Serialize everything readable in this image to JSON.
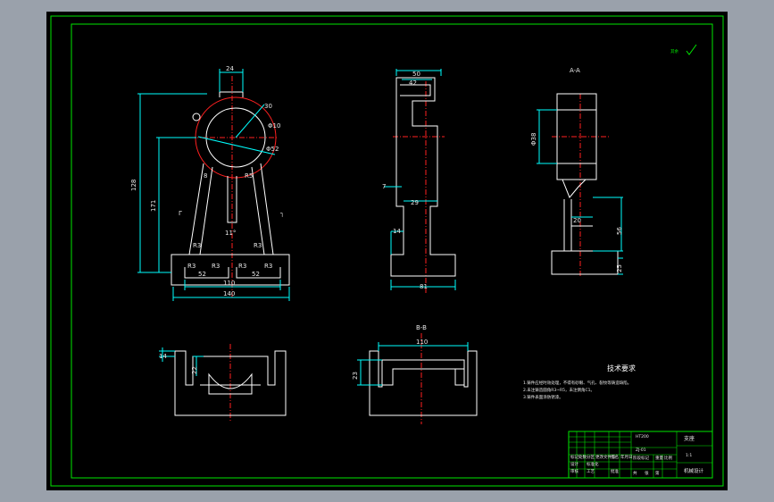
{
  "colors": {
    "background": "#000000",
    "frame": "#00e600",
    "outline": "#ffffff",
    "dimension": "#00ffff",
    "centerline": "#ff2020",
    "workspace": "#9aa1ab"
  },
  "front_view": {
    "dims": {
      "top_width": "24",
      "height_total": "128",
      "height_center": "171",
      "arc_r30": "30",
      "dia_phi10": "Φ10",
      "dia_phi52": "Φ52",
      "leg_r8_left": "8",
      "leg_r8_right": "R5",
      "fillet_left": "R3",
      "fillet_right": "R3",
      "angle": "11°",
      "base_r3_a": "R3",
      "base_r3_b": "R3",
      "base_r3_c": "R3",
      "base_r3_d": "R3",
      "slot_left": "52",
      "slot_right": "52",
      "inner_width": "110",
      "outer_width": "140",
      "section_mark_left": "Γ",
      "section_mark_right": "┐"
    }
  },
  "side_view": {
    "dims": {
      "top_outer": "50",
      "top_inner": "42",
      "step": "7",
      "neck": "29",
      "base_h": "14",
      "base_w": "81"
    }
  },
  "section_view": {
    "label": "A-A",
    "dims": {
      "bore": "Φ38",
      "rib": "20",
      "height": "56",
      "base": "25"
    }
  },
  "top_view_left": {
    "dims": {
      "wall": "14",
      "slot": "22"
    }
  },
  "top_view_right": {
    "label": "B-B",
    "dims": {
      "width": "110",
      "depth": "23"
    }
  },
  "roughness_note": "其余",
  "tech_requirements": {
    "title": "技术要求",
    "lines": [
      "1.铸件应经时效处理，不得有砂眼、气孔、裂纹等铸造缺陷。",
      "2.未注铸造圆角R3~R5，未注倒角C1。",
      "3.铸件表面涂防锈漆。"
    ]
  },
  "title_block": {
    "part_name": "支座",
    "drawing_no": "ZJ-01",
    "material": "HT200",
    "scale": "1:1",
    "company": "机械设计",
    "labels": [
      "标记",
      "处数",
      "分区",
      "更改文件号",
      "签名",
      "年月日",
      "设计",
      "标准化",
      "阶段标记",
      "重量",
      "比例",
      "审核",
      "工艺",
      "批准",
      "共",
      "张",
      "第"
    ]
  }
}
